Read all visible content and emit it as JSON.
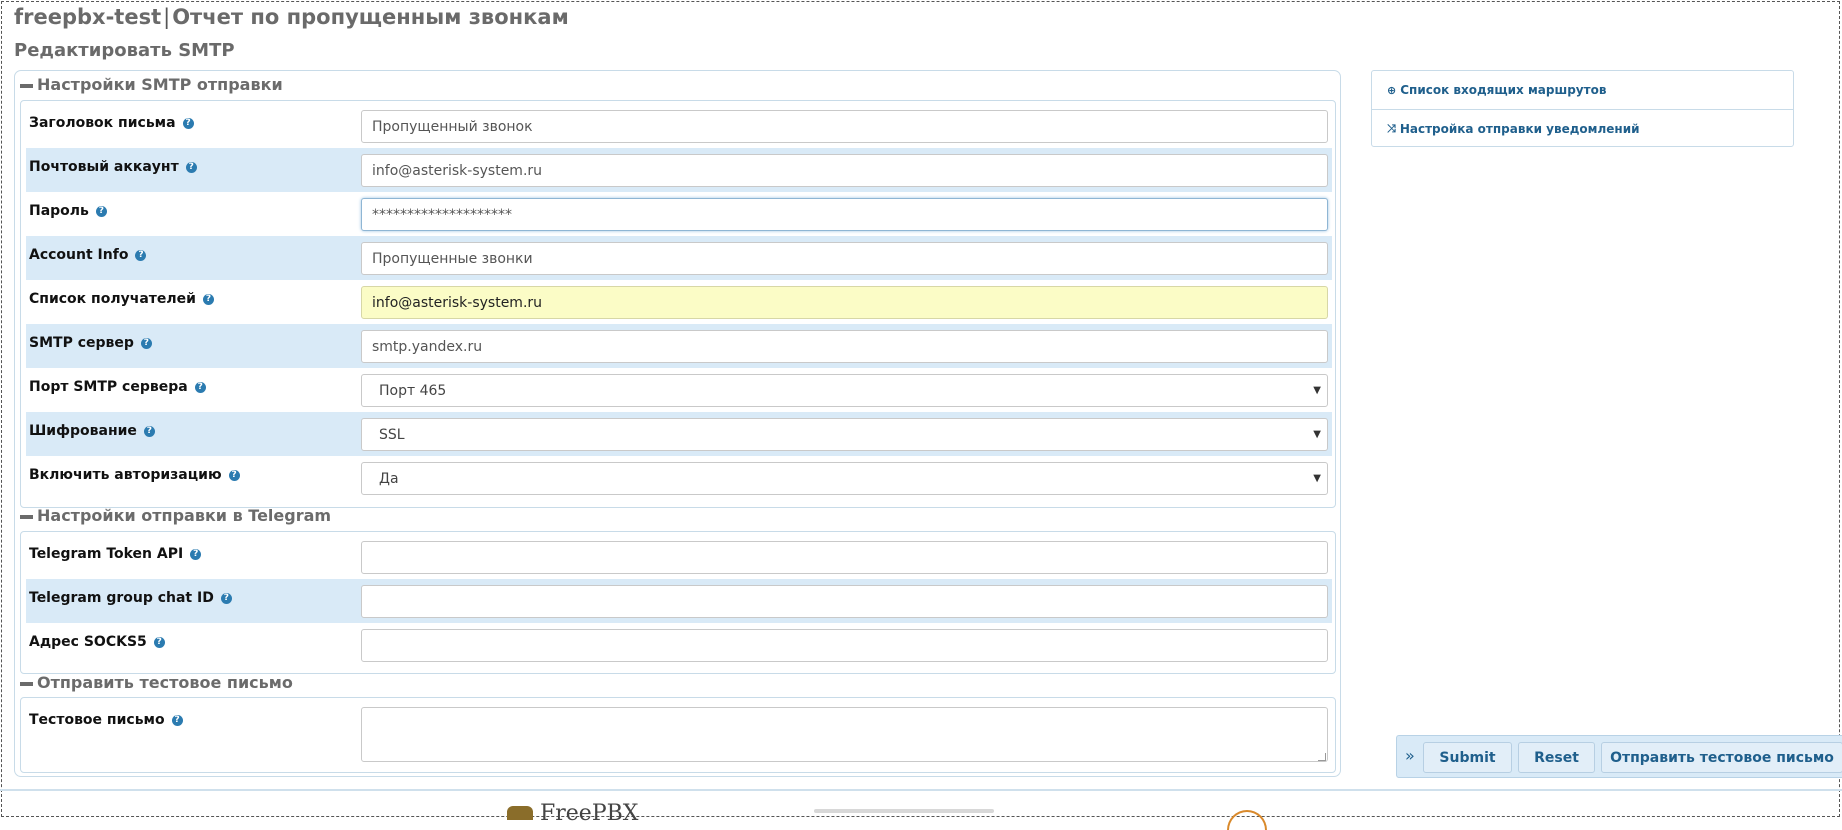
{
  "header": {
    "site": "freepbx-test",
    "separator": "|",
    "report": "Отчет по пропущенным звонкам",
    "subtitle": "Редактировать SMTP"
  },
  "smtp_section": {
    "title": "Настройки SMTP отправки",
    "fields": {
      "subject": {
        "label": "Заголовок письма",
        "value": "Пропущенный звонок"
      },
      "account": {
        "label": "Почтовый аккаунт",
        "value": "info@asterisk-system.ru"
      },
      "password": {
        "label": "Пароль",
        "value": "********************"
      },
      "account_info": {
        "label": "Account Info",
        "value": "Пропущенные звонки"
      },
      "recipients": {
        "label": "Список получателей",
        "value": "info@asterisk-system.ru"
      },
      "server": {
        "label": "SMTP сервер",
        "value": "smtp.yandex.ru"
      },
      "port": {
        "label": "Порт SMTP сервера",
        "value": "Порт 465"
      },
      "encryption": {
        "label": "Шифрование",
        "value": "SSL"
      },
      "auth": {
        "label": "Включить авторизацию",
        "value": "Да"
      }
    }
  },
  "telegram_section": {
    "title": "Настройки отправки в Telegram",
    "fields": {
      "token": {
        "label": "Telegram Token API",
        "value": ""
      },
      "chat_id": {
        "label": "Telegram group chat ID",
        "value": ""
      },
      "socks5": {
        "label": "Адрес SOCKS5",
        "value": ""
      }
    }
  },
  "test_section": {
    "title": "Отправить тестовое письмо",
    "fields": {
      "test_message": {
        "label": "Тестовое письмо",
        "value": ""
      }
    }
  },
  "sidebar": {
    "links": [
      {
        "label": "Список входящих маршрутов",
        "icon": "arrow-circle-down-icon"
      },
      {
        "label": "Настройка отправки уведомлений",
        "icon": "shuffle-icon"
      }
    ]
  },
  "actions": {
    "submit": "Submit",
    "reset": "Reset",
    "send_test": "Отправить тестовое письмо"
  },
  "footer": {
    "logo_text": "FreePBX"
  },
  "colors": {
    "accent": "#1f5f8c",
    "row_alt": "#d9eaf7",
    "highlight_field": "#fbfcc6",
    "help_icon": "#2b7bb0"
  }
}
